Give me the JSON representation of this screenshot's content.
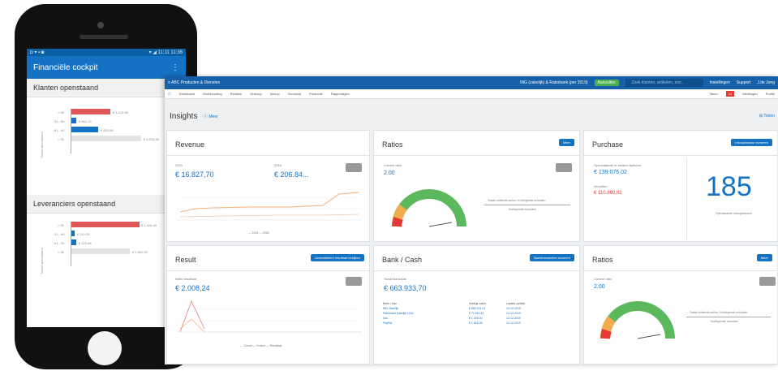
{
  "phone": {
    "status_left": "◘ ▾ ▪ ◙",
    "status_right": "▾ ◢ 11:11 11:36",
    "title": "Financiële cockpit",
    "menu_icon": "more-vert-icon",
    "section1": "Klanten openstaand",
    "section2": "Leveranciers openstaand",
    "chart1": {
      "y_title": "Totaal openstaand",
      "rows": [
        {
          "label": "> 90",
          "color": "#e05555",
          "value_text": "€ 1.213,95"
        },
        {
          "label": "31 - 60",
          "color": "#1472c4",
          "value_text": "€ 562,25"
        },
        {
          "label": "61 - 90",
          "color": "#1472c4",
          "value_text": "€ 653,65"
        },
        {
          "label": "< 30",
          "color": "#e3e3e3",
          "value_text": "€ 4.015,89"
        }
      ]
    },
    "chart2": {
      "y_title": "Totaal openstaand",
      "rows": [
        {
          "label": "> 90",
          "color": "#e05555",
          "value_text": "€ 1.326,48"
        },
        {
          "label": "31 - 60",
          "color": "#1472c4",
          "value_text": "€ 110,25"
        },
        {
          "label": "61 - 90",
          "color": "#1472c4",
          "value_text": "€ 122,68"
        },
        {
          "label": "< 30",
          "color": "#e3e3e3",
          "value_text": "€ 1.500,00"
        }
      ]
    }
  },
  "desktop": {
    "company": "≡  ABC Producten & Diensten",
    "topbar_info": "ING (zakelijk) & Rabobank (per 2019)",
    "topbar_badge": "Aanvullen",
    "search_placeholder": "Zoek klanten, artikelen, enz.",
    "topbar_links": [
      "Instellingen",
      "Support",
      "J.de Jong"
    ],
    "home_icon": "home-icon",
    "nav_items": [
      "Dashboard",
      "Boekhouding",
      "Relaties",
      "Verkoop",
      "Inkoop",
      "Voorraad",
      "Productie",
      "Rapportages"
    ],
    "nav_right": [
      "Taken",
      "Meldingen",
      "Profiel"
    ],
    "nav_badge": "12",
    "insights_title": "Insights",
    "insights_help": "ⓘ Meer",
    "grid_label": "⊞ Tonen",
    "cards": {
      "revenue": {
        "title": "Revenue",
        "lbl1": "2019",
        "val1": "€ 16.827,70",
        "lbl2": "2018",
        "val2": "€ 206.84...",
        "legend": "— 2019   — 2018"
      },
      "ratios1": {
        "title": "Ratios",
        "button": "Meer",
        "lbl": "Current ratio",
        "val": "2.00",
        "right1": "Totaal vlottende activa / Kortlopende schulden",
        "right2": "Kortlopende schulden"
      },
      "purchase": {
        "title": "Purchase",
        "button": "Inkoopfactuur invoeren",
        "lbl1": "Openstaande te betalen facturen",
        "val1": "€ 139.076,02",
        "lbl2": "Vervallen",
        "val2": "€ 110.880,02",
        "count": "185",
        "count_label": "Openstaande inkoopfacturen"
      },
      "result": {
        "title": "Result",
        "button": "Gedetailleerd resultaat bekijken",
        "lbl": "Netto resultaat",
        "val": "€ 2.008,24",
        "legend": "— Omzet   — Kosten   — Resultaat"
      },
      "bank": {
        "title": "Bank / Cash",
        "button": "Banktransacties invoeren",
        "lbl": "Totaal bank/kas",
        "val": "€ 663.933,70",
        "headers": [
          "Bank / Kas",
          "Huidige saldo",
          "Laatste update"
        ],
        "rows": [
          [
            "ING Zakelijk",
            "€ 582.101,91",
            "12-12-2019"
          ],
          [
            "Rabobank Zakelijk 1234",
            "€ 71.011,43",
            "12-12-2019"
          ],
          [
            "Kas",
            "€ 1.200,00",
            "12-12-2019"
          ],
          [
            "PayPal",
            "€ 1.615,35",
            "12-12-2019"
          ]
        ]
      },
      "ratios2": {
        "title": "Ratios",
        "button": "Meer",
        "lbl": "Current ratio",
        "val": "2.00",
        "right1": "Totaal vlottende activa / Kortlopende schulden",
        "right2": "Kortlopende schulden"
      }
    }
  }
}
